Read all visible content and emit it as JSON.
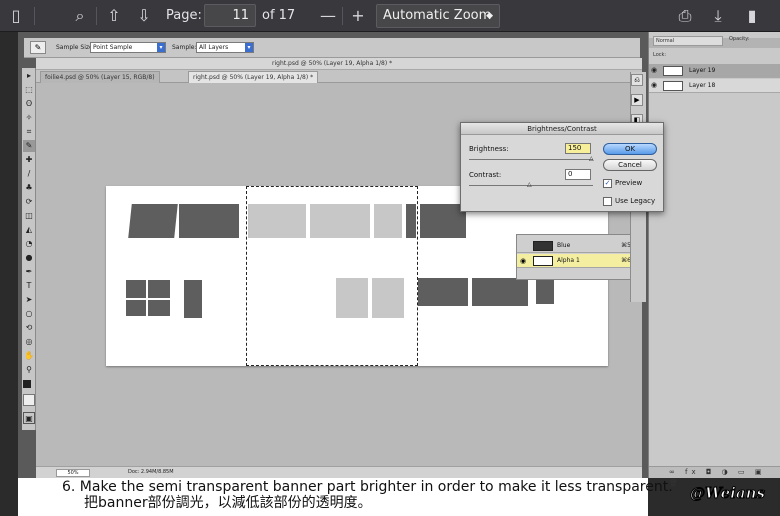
{
  "pdf_toolbar": {
    "page_label": "Page:",
    "page_current": "11",
    "page_total": "of 17",
    "zoom_value": "Automatic Zoom",
    "icons": [
      "sidebar-toggle-icon",
      "search-icon",
      "previous-page-icon",
      "next-page-icon",
      "zoom-out-icon",
      "zoom-in-icon",
      "print-icon",
      "download-icon",
      "bookmark-icon"
    ]
  },
  "photoshop": {
    "options_bar": {
      "sample_size_label": "Sample Size:",
      "sample_size_value": "Point Sample",
      "sample_label": "Sample:",
      "sample_value": "All Layers"
    },
    "doc_title": "right.psd @ 50% (Layer 19, Alpha 1/8) *",
    "tabs": [
      {
        "label": "foilie4.psd @ 50% (Layer 15, RGB/8)"
      },
      {
        "label": "right.psd @ 50% (Layer 19, Alpha 1/8) *"
      }
    ],
    "status": {
      "zoom": "50%",
      "doc_size": "Doc: 2.94M/8.85M"
    },
    "layers": {
      "blend_mode": "Normal",
      "opacity_label": "Opacity:",
      "lock_label": "Lock:",
      "items": [
        {
          "name": "Layer 19"
        },
        {
          "name": "Layer 18"
        }
      ],
      "footer_icons": "∞ fx ◘ ◑ ▭ ▣ 🗑"
    },
    "channels": {
      "items": [
        {
          "name": "Blue",
          "shortcut": "⌘5"
        },
        {
          "name": "Alpha 1",
          "shortcut": "⌘6"
        }
      ]
    },
    "dialog": {
      "title": "Brightness/Contrast",
      "brightness_label": "Brightness:",
      "brightness_value": "150",
      "contrast_label": "Contrast:",
      "contrast_value": "0",
      "ok_label": "OK",
      "cancel_label": "Cancel",
      "preview_label": "Preview",
      "preview_checked": true,
      "legacy_label": "Use Legacy",
      "legacy_checked": false
    }
  },
  "caption": {
    "english": "6. Make the semi transparent banner part brighter in order to make it less transparent.",
    "chinese": "把banner部份調光，以減低該部份的透明度。"
  },
  "watermark": "@Weians"
}
